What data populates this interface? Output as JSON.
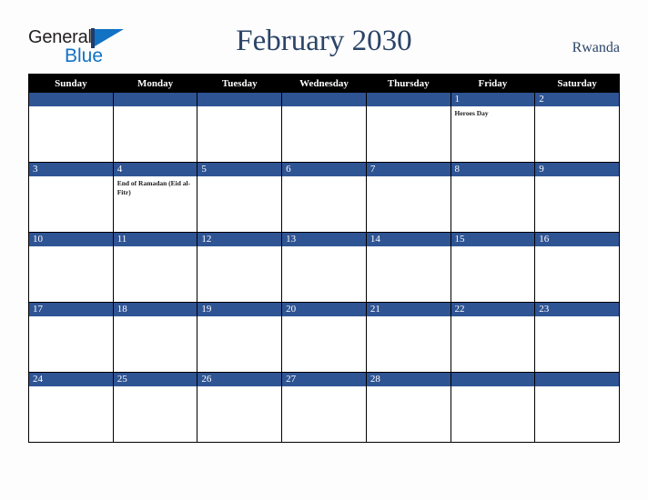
{
  "logo": {
    "word_one": "General",
    "word_two": "Blue",
    "mark": "triangle-logo-icon"
  },
  "header": {
    "title": "February 2030",
    "country": "Rwanda"
  },
  "colors": {
    "day_band": "#2f5494",
    "header_row": "#000000",
    "title_text": "#2b4468",
    "logo_blue": "#1272c4",
    "logo_dark": "#231f20",
    "cell_background": "#ffffff",
    "page_background": "#fdfdfd"
  },
  "calendar": {
    "weekday_headers": [
      "Sunday",
      "Monday",
      "Tuesday",
      "Wednesday",
      "Thursday",
      "Friday",
      "Saturday"
    ],
    "weeks": [
      [
        {
          "day": "",
          "events": []
        },
        {
          "day": "",
          "events": []
        },
        {
          "day": "",
          "events": []
        },
        {
          "day": "",
          "events": []
        },
        {
          "day": "",
          "events": []
        },
        {
          "day": "1",
          "events": [
            "Heroes Day"
          ]
        },
        {
          "day": "2",
          "events": []
        }
      ],
      [
        {
          "day": "3",
          "events": []
        },
        {
          "day": "4",
          "events": [
            "End of Ramadan (Eid al-Fitr)"
          ]
        },
        {
          "day": "5",
          "events": []
        },
        {
          "day": "6",
          "events": []
        },
        {
          "day": "7",
          "events": []
        },
        {
          "day": "8",
          "events": []
        },
        {
          "day": "9",
          "events": []
        }
      ],
      [
        {
          "day": "10",
          "events": []
        },
        {
          "day": "11",
          "events": []
        },
        {
          "day": "12",
          "events": []
        },
        {
          "day": "13",
          "events": []
        },
        {
          "day": "14",
          "events": []
        },
        {
          "day": "15",
          "events": []
        },
        {
          "day": "16",
          "events": []
        }
      ],
      [
        {
          "day": "17",
          "events": []
        },
        {
          "day": "18",
          "events": []
        },
        {
          "day": "19",
          "events": []
        },
        {
          "day": "20",
          "events": []
        },
        {
          "day": "21",
          "events": []
        },
        {
          "day": "22",
          "events": []
        },
        {
          "day": "23",
          "events": []
        }
      ],
      [
        {
          "day": "24",
          "events": []
        },
        {
          "day": "25",
          "events": []
        },
        {
          "day": "26",
          "events": []
        },
        {
          "day": "27",
          "events": []
        },
        {
          "day": "28",
          "events": []
        },
        {
          "day": "",
          "events": []
        },
        {
          "day": "",
          "events": []
        }
      ]
    ]
  }
}
